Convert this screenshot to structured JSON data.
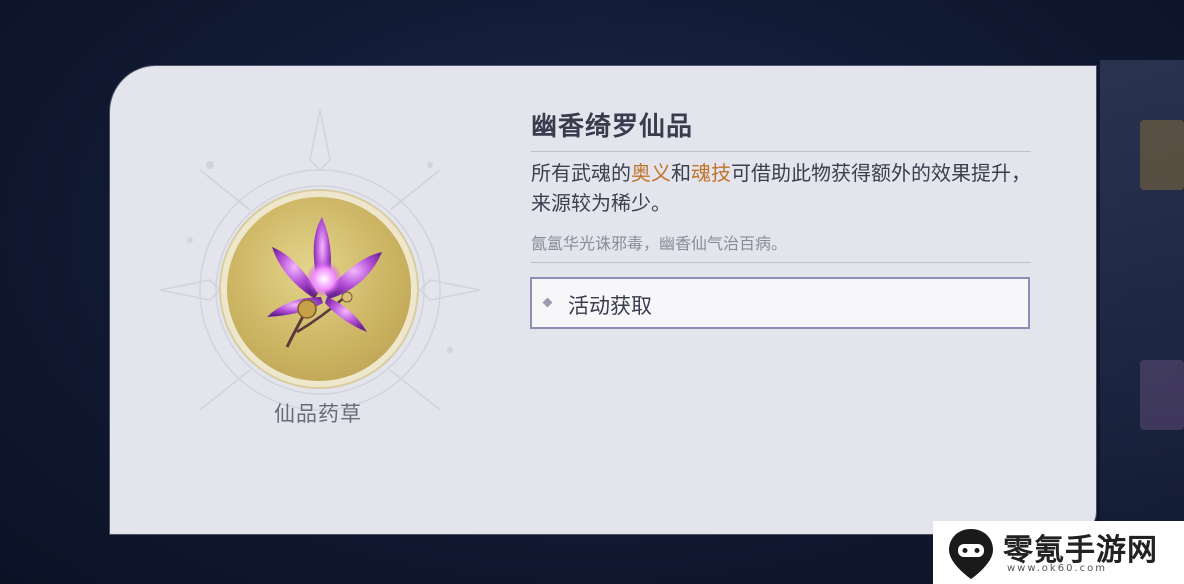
{
  "item": {
    "name": "幽香绮罗仙品",
    "type": "仙品药草",
    "description_parts": [
      "所有武魂的",
      "奥义",
      "和",
      "魂技",
      "可借助此物获得额外的效果提升，来源较为稀少。"
    ],
    "flavor": "氤氲华光诛邪毒，幽香仙气治百病。",
    "icon": "purple-flower-icon"
  },
  "source": {
    "label": "活动获取"
  },
  "colors": {
    "highlight": "#c0742a",
    "card_bg": "#e4e4ec",
    "border": "#8c8eb5"
  },
  "watermark": {
    "text": "零氪手游网",
    "url": "www.ok60.com"
  }
}
